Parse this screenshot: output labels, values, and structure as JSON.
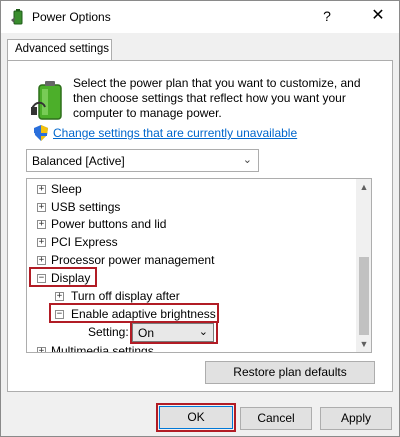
{
  "window": {
    "title": "Power Options",
    "help_glyph": "?",
    "close_glyph": "✕"
  },
  "tab": {
    "label": "Advanced settings"
  },
  "intro": {
    "text": "Select the power plan that you want to customize, and then choose settings that reflect how you want your computer to manage power."
  },
  "change_link": "Change settings that are currently unavailable",
  "plan": {
    "selected": "Balanced [Active]"
  },
  "tree": {
    "items": [
      {
        "label": "Sleep",
        "expander": "+"
      },
      {
        "label": "USB settings",
        "expander": "+"
      },
      {
        "label": "Power buttons and lid",
        "expander": "+"
      },
      {
        "label": "PCI Express",
        "expander": "+"
      },
      {
        "label": "Processor power management",
        "expander": "+"
      },
      {
        "label": "Display",
        "expander": "−"
      },
      {
        "label": "Turn off display after",
        "expander": "+"
      },
      {
        "label": "Enable adaptive brightness",
        "expander": "−"
      },
      {
        "label": "Multimedia settings",
        "expander": "+"
      }
    ],
    "setting_label": "Setting:",
    "setting_value": "On"
  },
  "buttons": {
    "restore": "Restore plan defaults",
    "ok": "OK",
    "cancel": "Cancel",
    "apply": "Apply"
  },
  "colors": {
    "highlight": "#b11c25",
    "link": "#0066cc",
    "focus": "#0078d7"
  },
  "icons": {
    "app": "power-options-icon",
    "battery": "battery-plan-icon",
    "shield": "uac-shield-icon"
  }
}
